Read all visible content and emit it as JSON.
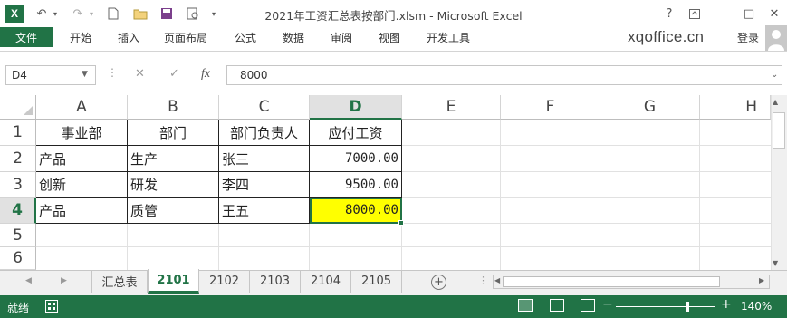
{
  "window": {
    "title": "2021年工资汇总表按部门.xlsm - Microsoft Excel",
    "help": "?",
    "minimize": "—",
    "maximize": "□",
    "close": "✕"
  },
  "ribbon": {
    "tabs": [
      "文件",
      "开始",
      "插入",
      "页面布局",
      "公式",
      "数据",
      "审阅",
      "视图",
      "开发工具"
    ],
    "brand": "xqoffice.cn",
    "login": "登录"
  },
  "formula_bar": {
    "name_box": "D4",
    "cancel": "✕",
    "enter": "✓",
    "fx": "fx",
    "value": "8000"
  },
  "columns": [
    "A",
    "B",
    "C",
    "D",
    "E",
    "F",
    "G",
    "H"
  ],
  "selected_column": "D",
  "rows": [
    "1",
    "2",
    "3",
    "4",
    "5",
    "6"
  ],
  "selected_row": "4",
  "cells": [
    [
      "事业部",
      "部门",
      "部门负责人",
      "应付工资"
    ],
    [
      "产品",
      "生产",
      "张三",
      "7000.00"
    ],
    [
      "创新",
      "研发",
      "李四",
      "9500.00"
    ],
    [
      "产品",
      "质管",
      "王五",
      "8000.00"
    ]
  ],
  "highlight_color": "#ffff00",
  "accent_color": "#217346",
  "sheets": [
    "汇总表",
    "2101",
    "2102",
    "2103",
    "2104",
    "2105"
  ],
  "active_sheet": "2101",
  "status": {
    "text": "就绪",
    "zoom": "140%",
    "zoom_minus": "−",
    "zoom_plus": "+"
  }
}
